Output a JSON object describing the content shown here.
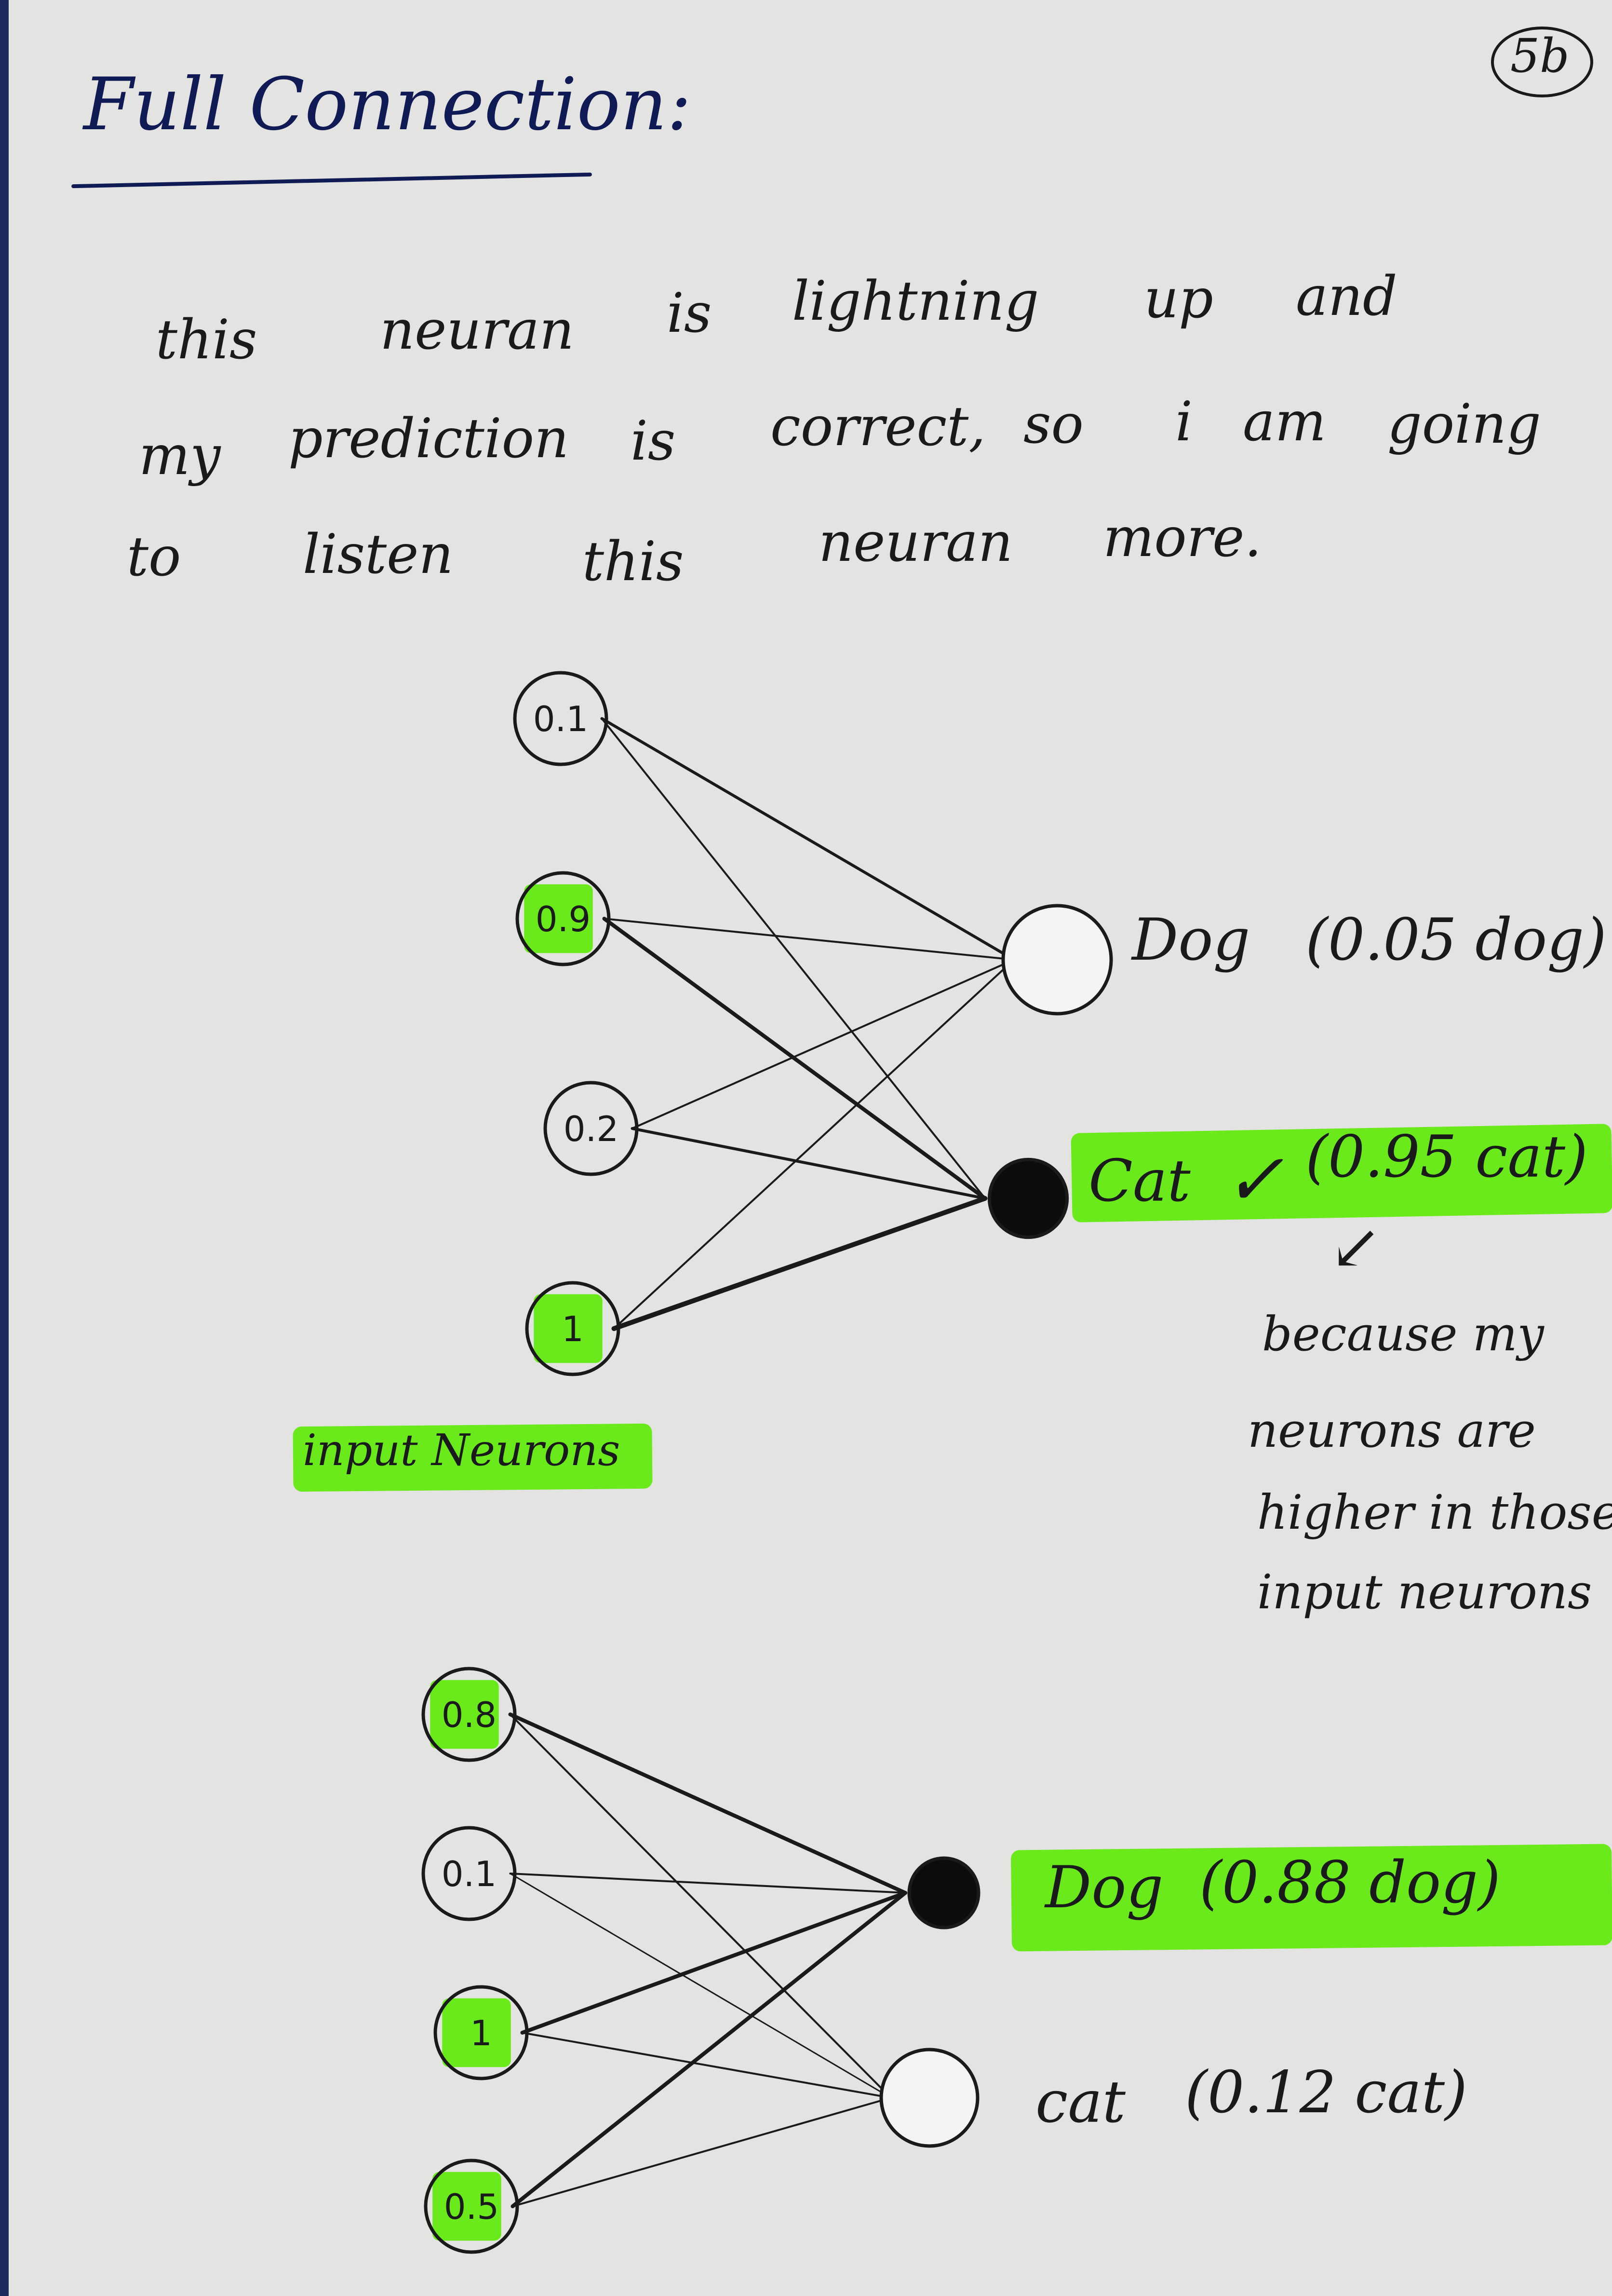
{
  "page_number": "5b",
  "title": "Full Connection:",
  "intro": [
    [
      "this",
      "neuran",
      "is",
      "lightning",
      "up",
      "and"
    ],
    [
      "my",
      "prediction",
      "is",
      "correct,",
      "so",
      "i",
      "am",
      "going"
    ],
    [
      "to",
      "listen",
      "this",
      "neuran",
      "more."
    ]
  ],
  "net1": {
    "inputs": [
      "0.1",
      "0.9",
      "0.2",
      "1"
    ],
    "highlighted_inputs": [
      false,
      true,
      false,
      true
    ],
    "outputs": [
      "Dog",
      "Cat"
    ],
    "output_active": [
      false,
      true
    ],
    "output_probs": [
      "(0.05 dog)",
      "(0.95 cat)"
    ],
    "check_mark": "✓",
    "input_label": "input Neurons",
    "note_arrow": "↙",
    "note_lines": [
      "because my",
      "neurons are",
      "higher in those",
      "input neurons"
    ]
  },
  "net2": {
    "inputs": [
      "0.8",
      "0.1",
      "1",
      "0.5"
    ],
    "highlighted_inputs": [
      true,
      false,
      true,
      true
    ],
    "outputs": [
      "Dog",
      "cat"
    ],
    "output_active": [
      true,
      false
    ],
    "output_probs": [
      "(0.88 dog)",
      "(0.12 cat)"
    ]
  },
  "colors": {
    "highlight": "#6aea1a",
    "ink": "#1a1a1a",
    "title_ink": "#101a55",
    "paper": "#e3e3e1"
  }
}
